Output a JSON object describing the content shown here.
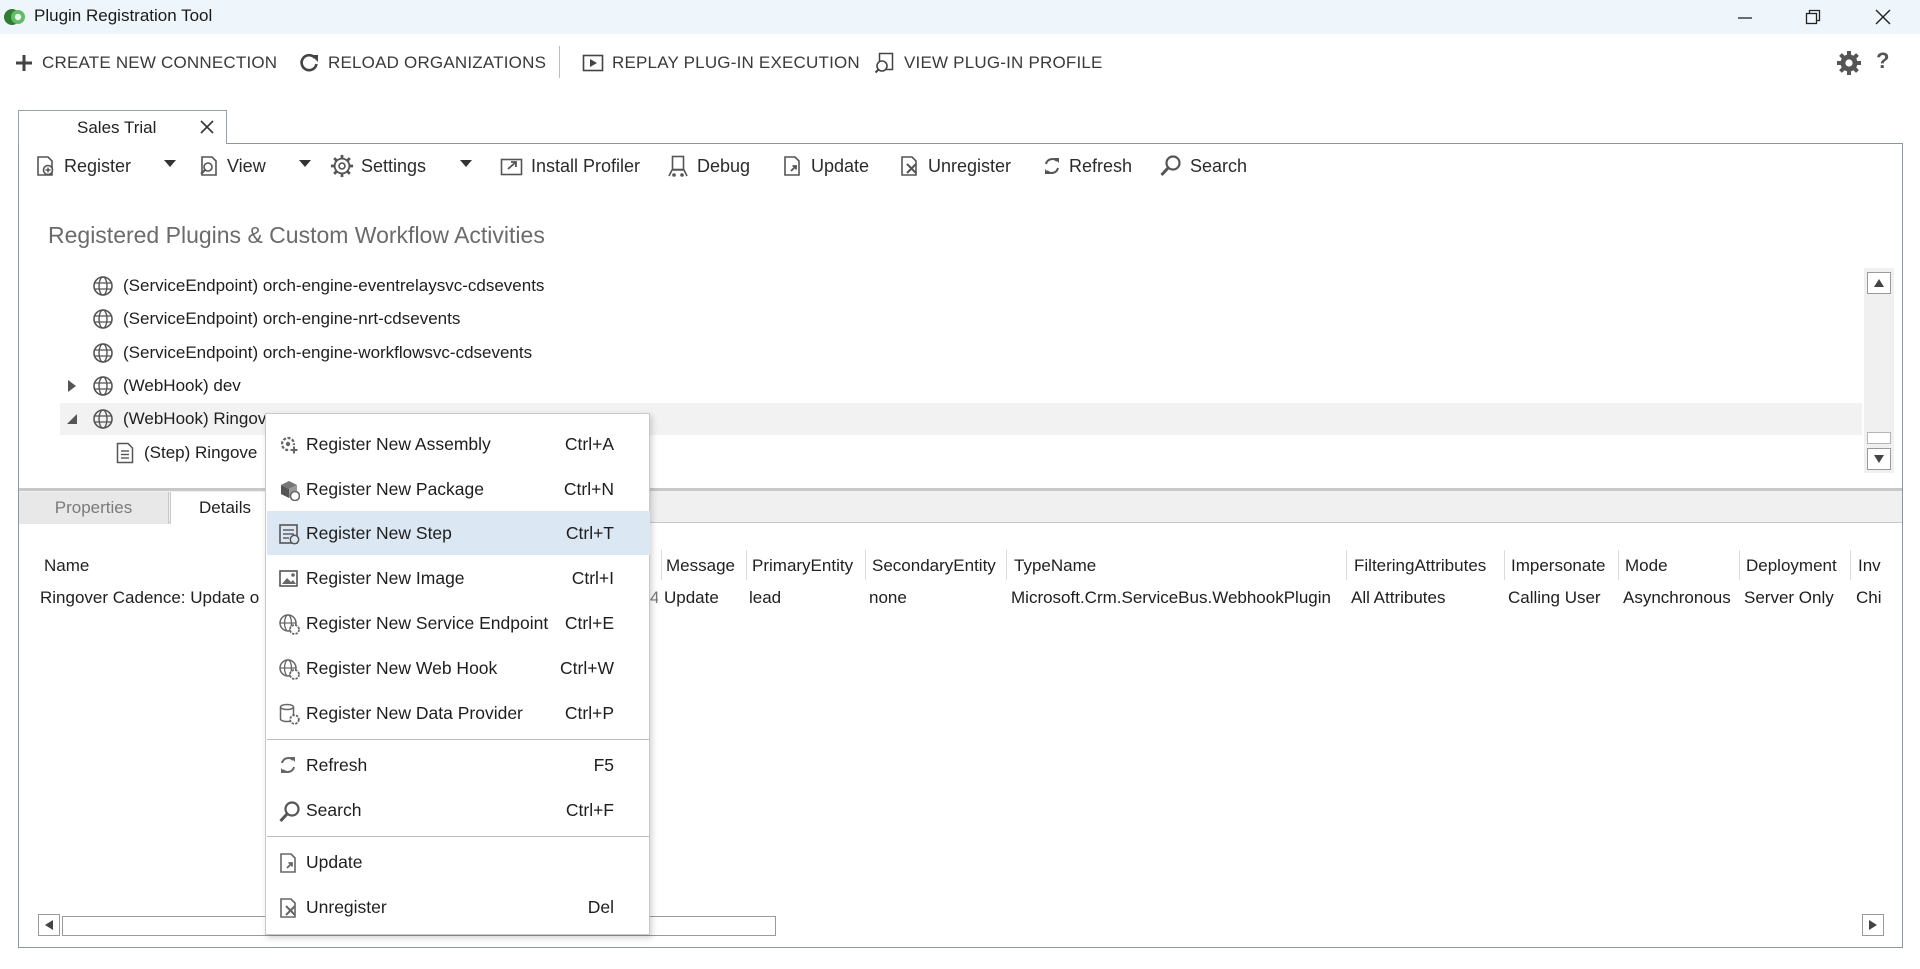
{
  "window": {
    "title": "Plugin Registration Tool",
    "brand_color": "#2e7d32"
  },
  "command_bar": {
    "create_connection": "CREATE NEW CONNECTION",
    "reload_organizations": "RELOAD ORGANIZATIONS",
    "replay_execution": "REPLAY PLUG-IN EXECUTION",
    "view_profile": "VIEW PLUG-IN PROFILE",
    "help_glyph": "?"
  },
  "connection_tab": {
    "label": "Sales Trial"
  },
  "toolbar": {
    "register": "Register",
    "view": "View",
    "settings": "Settings",
    "install_profiler": "Install Profiler",
    "debug": "Debug",
    "update": "Update",
    "unregister": "Unregister",
    "refresh": "Refresh",
    "search": "Search"
  },
  "tree": {
    "heading": "Registered Plugins & Custom Workflow Activities",
    "rows": [
      {
        "label": "(ServiceEndpoint) orch-engine-eventrelaysvc-cdsevents",
        "icon": "globe-icon"
      },
      {
        "label": "(ServiceEndpoint) orch-engine-nrt-cdsevents",
        "icon": "globe-icon"
      },
      {
        "label": "(ServiceEndpoint) orch-engine-workflowsvc-cdsevents",
        "icon": "globe-icon"
      },
      {
        "label": "(WebHook) dev",
        "icon": "globe-icon"
      },
      {
        "label": "(WebHook) Ringov",
        "icon": "globe-icon"
      },
      {
        "label": "(Step) Ringove",
        "icon": "step-icon"
      }
    ]
  },
  "lower_tabs": {
    "properties": "Properties",
    "details": "Details"
  },
  "grid": {
    "headers": {
      "name": "Name",
      "message": "Message",
      "primary_entity": "PrimaryEntity",
      "secondary_entity": "SecondaryEntity",
      "type_name": "TypeName",
      "filtering_attributes": "FilteringAttributes",
      "impersonate": "Impersonate",
      "mode": "Mode",
      "deployment": "Deployment",
      "inv": "Inv"
    },
    "row": {
      "name": "Ringover Cadence: Update o",
      "message": "Update",
      "primary_entity": "lead",
      "secondary_entity": "none",
      "type_name": "Microsoft.Crm.ServiceBus.WebhookPlugin",
      "filtering_attributes": "All Attributes",
      "impersonate": "Calling User",
      "mode": "Asynchronous",
      "deployment": "Server Only",
      "inv": "Chi"
    }
  },
  "context_menu": {
    "items": [
      {
        "label": "Register New Assembly",
        "shortcut": "Ctrl+A",
        "icon": "gear-plus-icon"
      },
      {
        "label": "Register New Package",
        "shortcut": "Ctrl+N",
        "icon": "package-icon"
      },
      {
        "label": "Register New Step",
        "shortcut": "Ctrl+T",
        "icon": "step-icon"
      },
      {
        "label": "Register New Image",
        "shortcut": "Ctrl+I",
        "icon": "image-icon"
      },
      {
        "label": "Register New Service Endpoint",
        "shortcut": "Ctrl+E",
        "icon": "globe-gear-icon"
      },
      {
        "label": "Register New Web Hook",
        "shortcut": "Ctrl+W",
        "icon": "globe-gear-icon"
      },
      {
        "label": "Register New Data Provider",
        "shortcut": "Ctrl+P",
        "icon": "database-icon"
      },
      {
        "label": "Refresh",
        "shortcut": "F5",
        "icon": "refresh-icon"
      },
      {
        "label": "Search",
        "shortcut": "Ctrl+F",
        "icon": "search-icon"
      },
      {
        "label": "Update",
        "shortcut": "",
        "icon": "update-icon"
      },
      {
        "label": "Unregister",
        "shortcut": "Del",
        "icon": "unregister-icon"
      }
    ],
    "highlight_color": "#dbe7f3"
  }
}
